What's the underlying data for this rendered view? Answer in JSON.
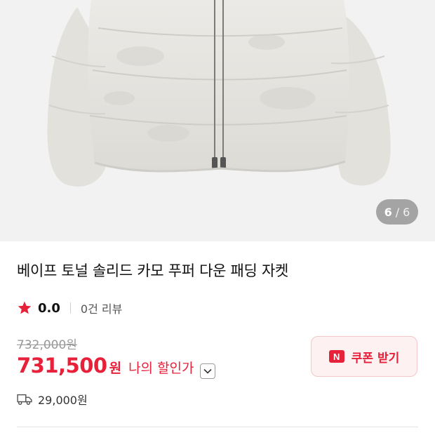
{
  "gallery": {
    "current": "6",
    "separator": "/",
    "total": "6"
  },
  "product": {
    "title": "베이프 토널 솔리드 카모 푸퍼 다운 패딩 자켓",
    "rating": "0.0",
    "review_count": "0건 리뷰"
  },
  "price": {
    "original": "732,000원",
    "sale_amount": "731,500",
    "sale_unit": "원",
    "discount_label": "나의 할인가"
  },
  "coupon": {
    "logo_letter": "N",
    "label": "쿠폰 받기"
  },
  "shipping": {
    "fee": "29,000원"
  },
  "colors": {
    "accent": "#e8213a",
    "star": "#e8213a",
    "coupon_bg": "#fdf1f2"
  }
}
